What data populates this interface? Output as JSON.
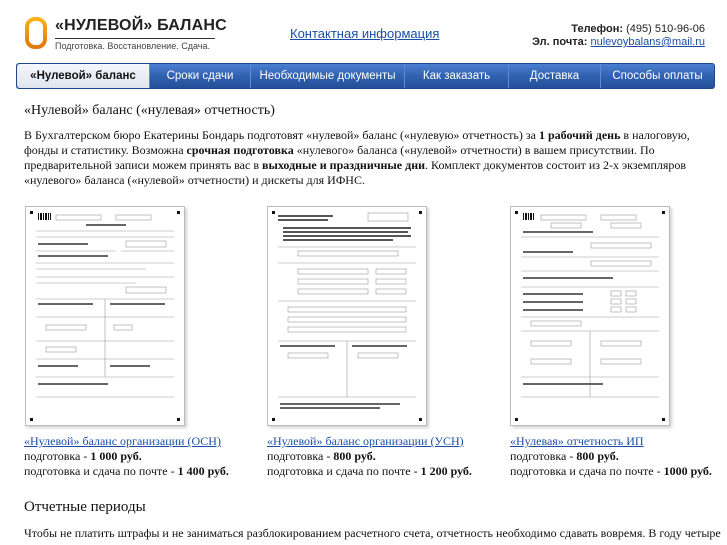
{
  "header": {
    "logo_title": "«НУЛЕВОЙ» БАЛАНС",
    "logo_subtitle": "Подготовка. Восстановление. Сдача.",
    "contacts_link": "Контактная информация",
    "phone_label": "Телефон:",
    "phone_value": "(495) 510-96-06",
    "email_label": "Эл. почта:",
    "email_value": "nulevoybalans@mail.ru"
  },
  "nav": {
    "items": [
      {
        "label": "«Нулевой» баланс"
      },
      {
        "label": "Сроки сдачи"
      },
      {
        "label": "Необходимые документы"
      },
      {
        "label": "Как заказать"
      },
      {
        "label": "Доставка"
      },
      {
        "label": "Способы оплаты"
      }
    ]
  },
  "main": {
    "title": "«Нулевой» баланс («нулевая» отчетность)",
    "intro_1": "В Бухгалтерском бюро Екатерины Бондарь подготовят «нулевой» баланс («нулевую» отчетность) за ",
    "intro_b1": "1 рабочий день",
    "intro_2": " в налоговую, фонды и статистику.  Возможна ",
    "intro_b2": "срочная подготовка",
    "intro_3": " «нулевого» баланса («нулевой» отчетности) в вашем присутствии. По предварительной записи можем принять вас в ",
    "intro_b3": "выходные и праздничные дни",
    "intro_4": ". Комплект документов состоит из 2-х экземпляров «нулевого» баланса («нулевой» отчетности) и дискеты для ИФНС.",
    "cards": [
      {
        "link": "«Нулевой» баланс организации (ОСН)",
        "line1_label": "подготовка - ",
        "line1_price": "1 000 руб.",
        "line2_label": "подготовка и сдача по почте - ",
        "line2_price": "1 400 руб."
      },
      {
        "link": "«Нулевой» баланс организации (УСН)",
        "line1_label": "подготовка - ",
        "line1_price": "800 руб.",
        "line2_label": "подготовка и сдача по почте - ",
        "line2_price": "1 200 руб."
      },
      {
        "link": "«Нулевая» отчетность ИП",
        "line1_label": "подготовка - ",
        "line1_price": "800 руб.",
        "line2_label": "подготовка и сдача по почте - ",
        "line2_price": "1000 руб."
      }
    ],
    "section_title": "Отчетные периоды",
    "section_text": "Чтобы не платить штрафы и не заниматься разблокированием расчетного счета, отчетность необходимо сдавать вовремя. В году четыре"
  }
}
